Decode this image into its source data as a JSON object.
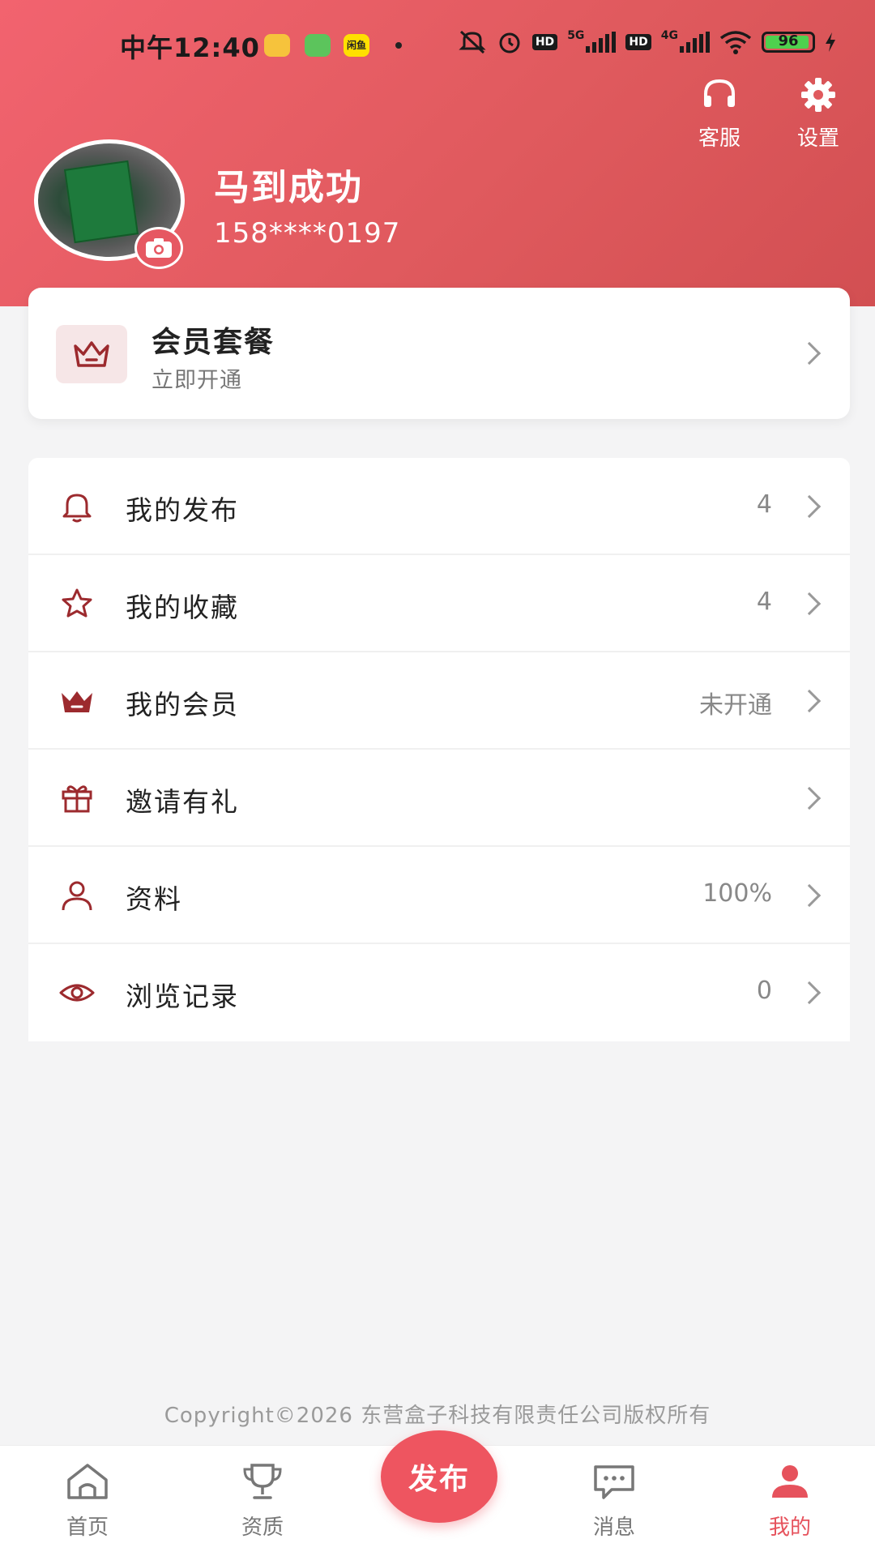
{
  "status_bar": {
    "time": "中午12:40",
    "app3": "闲鱼",
    "battery": "96",
    "net1": "5G",
    "net2": "4G",
    "hd": "HD"
  },
  "header": {
    "service_label": "客服",
    "settings_label": "设置"
  },
  "user": {
    "name": "马到成功",
    "phone": "158****0197"
  },
  "member_card": {
    "title": "会员套餐",
    "subtitle": "立即开通"
  },
  "menu": [
    {
      "label": "我的发布",
      "value": "4",
      "icon": "bell-icon"
    },
    {
      "label": "我的收藏",
      "value": "4",
      "icon": "star-icon"
    },
    {
      "label": "我的会员",
      "value": "未开通",
      "icon": "crown-icon"
    },
    {
      "label": "邀请有礼",
      "value": "",
      "icon": "gift-icon"
    },
    {
      "label": "资料",
      "value": "100%",
      "icon": "person-icon"
    },
    {
      "label": "浏览记录",
      "value": "0",
      "icon": "eye-icon"
    }
  ],
  "footer": {
    "copyright": "Copyright©2026 东营盒子科技有限责任公司版权所有"
  },
  "tabbar": {
    "home": "首页",
    "qualification": "资质",
    "publish": "发布",
    "messages": "消息",
    "mine": "我的"
  },
  "colors": {
    "accent": "#e6525c",
    "icon": "#9c2a2e"
  }
}
